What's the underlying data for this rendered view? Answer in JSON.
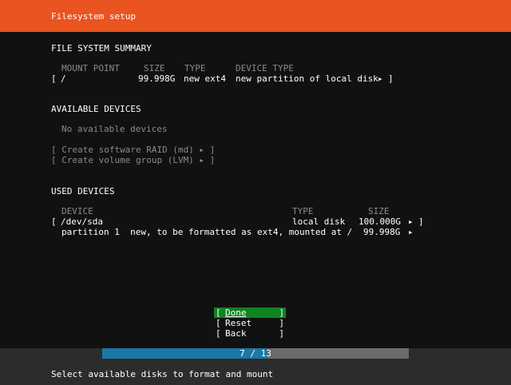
{
  "header": {
    "title": "Filesystem setup"
  },
  "summary": {
    "heading": "FILE SYSTEM SUMMARY",
    "columns": {
      "mount_point": "MOUNT POINT",
      "size": "SIZE",
      "type": "TYPE",
      "device_type": "DEVICE TYPE"
    },
    "row": {
      "open": "[",
      "mount_point": "/",
      "size": "99.998G",
      "type": "new ext4",
      "device_type": "new partition of local disk",
      "arrow": "▸",
      "close": "]"
    }
  },
  "available": {
    "heading": "AVAILABLE DEVICES",
    "empty": "No available devices",
    "actions": [
      "[ Create software RAID (md) ▸ ]",
      "[ Create volume group (LVM) ▸ ]"
    ]
  },
  "used": {
    "heading": "USED DEVICES",
    "columns": {
      "device": "DEVICE",
      "type": "TYPE",
      "size": "SIZE"
    },
    "disk": {
      "open": "[",
      "device": "/dev/sda",
      "type": "local disk",
      "size": "100.000G",
      "arrow": "▸",
      "close": "]"
    },
    "partition": {
      "label": "partition 1  new, to be formatted as ext4, mounted at /",
      "size": "99.998G",
      "arrow": "▸"
    }
  },
  "buttons": {
    "done": {
      "open": "[",
      "label": "Done",
      "close": "]"
    },
    "reset": {
      "open": "[",
      "label": "Reset",
      "close": "]"
    },
    "back": {
      "open": "[",
      "label": "Back",
      "close": "]"
    }
  },
  "progress": {
    "label": "7 / 13",
    "current": 7,
    "total": 13
  },
  "footer": {
    "hint": "Select available disks to format and mount"
  }
}
